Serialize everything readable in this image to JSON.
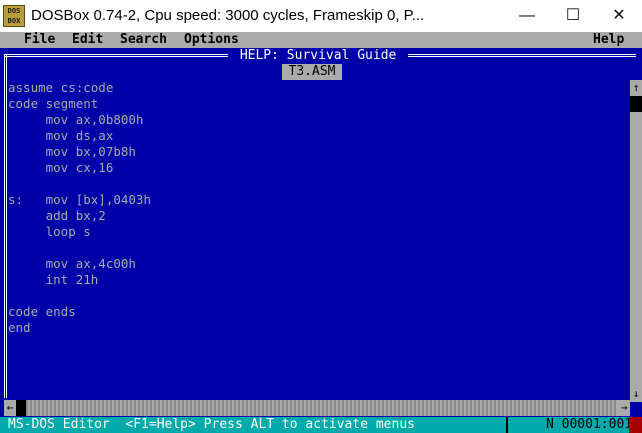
{
  "window": {
    "title": "DOSBox 0.74-2, Cpu speed:     3000 cycles, Frameskip  0, P...",
    "icon_text": "DOS BOX",
    "controls": {
      "minimize": "—",
      "maximize": "☐",
      "close": "✕"
    }
  },
  "menubar": {
    "file": "File",
    "edit": "Edit",
    "search": "Search",
    "options": "Options",
    "help": "Help"
  },
  "editor": {
    "help_title": " HELP: Survival Guide ",
    "file_tab": "T3.ASM",
    "code_text": "assume cs:code\ncode segment\n     mov ax,0b800h\n     mov ds,ax\n     mov bx,07b8h\n     mov cx,16\n\ns:   mov [bx],0403h\n     add bx,2\n     loop s\n\n     mov ax,4c00h\n     int 21h\n\ncode ends\nend"
  },
  "scrollbars": {
    "up_arrow": "↑",
    "down_arrow": "↓",
    "left_arrow": "←",
    "right_arrow": "→"
  },
  "status": {
    "left": "MS-DOS Editor  <F1=Help> Press ALT to activate menus",
    "position": "N 00001:001"
  },
  "colors": {
    "dos_blue": "#0000a8",
    "dos_grey": "#aaaaaa",
    "dos_cyan": "#00aaaa",
    "dos_white": "#ffffff",
    "dos_red": "#a80000"
  }
}
